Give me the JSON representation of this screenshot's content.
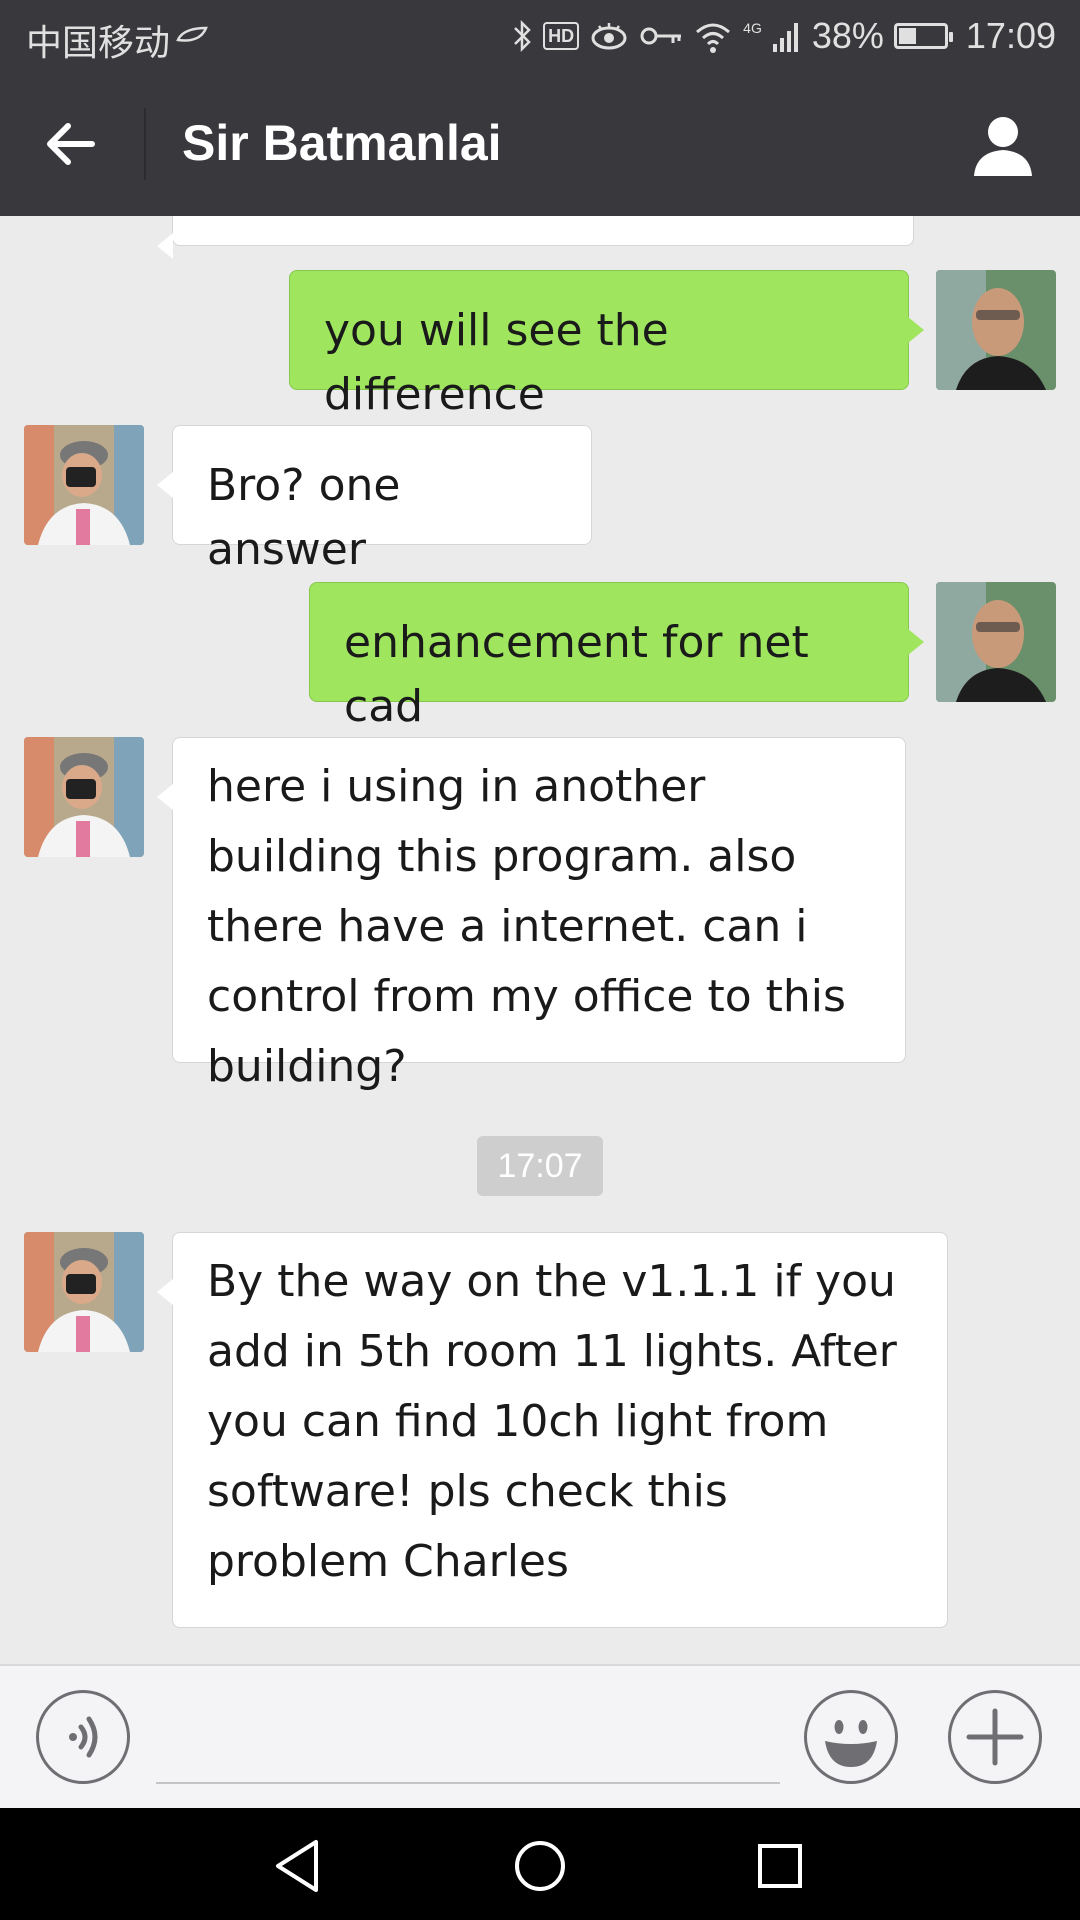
{
  "status_bar": {
    "carrier": "中国移动",
    "hd_label": "HD",
    "network": "4G",
    "battery": "38%",
    "battery_level": 0.38,
    "time": "17:09"
  },
  "header": {
    "title": "Sir Batmanlai",
    "back_icon": "arrow-left-icon",
    "profile_icon": "person-icon"
  },
  "messages": [
    {
      "side": "out",
      "text": "you will see the difference"
    },
    {
      "side": "in",
      "text": "Bro? one answer"
    },
    {
      "side": "out",
      "text": "enhancement for net cad"
    },
    {
      "side": "in",
      "text": "here i using in another building this program. also there have a internet. can i control from my office to this building?"
    },
    {
      "side": "in",
      "text": "By the way on the v1.1.1 if you add in 5th room 11 lights. After you can find 10ch light from software! pls check this problem Charles"
    }
  ],
  "timestamp": "17:07",
  "input_bar": {
    "voice_icon": "voice-icon",
    "emoji_icon": "emoji-icon",
    "plus_icon": "plus-icon",
    "message_value": ""
  },
  "colors": {
    "header_bg": "#39393d",
    "chat_bg": "#ebebeb",
    "outgoing_bubble": "#9fe65e",
    "incoming_bubble": "#ffffff"
  }
}
